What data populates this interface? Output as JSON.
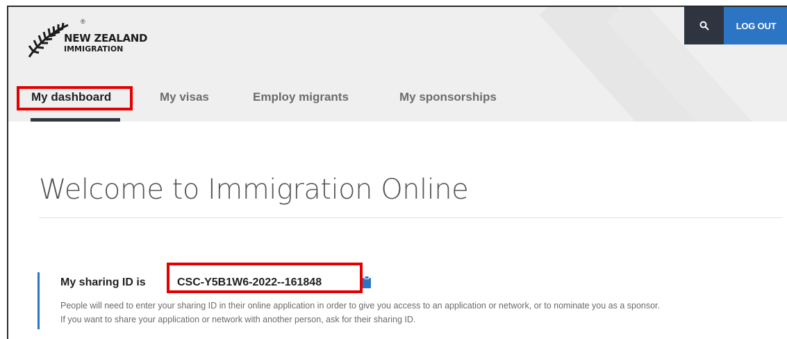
{
  "header": {
    "logo_line1": "NEW ZEALAND",
    "logo_line2": "IMMIGRATION",
    "logo_reg": "®",
    "search_icon": "search-icon",
    "logout_label": "LOG OUT"
  },
  "tabs": [
    {
      "label": "My dashboard",
      "active": true
    },
    {
      "label": "My visas",
      "active": false
    },
    {
      "label": "Employ migrants",
      "active": false
    },
    {
      "label": "My sponsorships",
      "active": false
    }
  ],
  "main": {
    "title": "Welcome to Immigration Online",
    "sharing_label": "My sharing ID is",
    "sharing_id": "CSC-Y5B1W6-2022--161848",
    "copy_icon": "copy-clipboard-icon",
    "description_line1": "People will need to enter your sharing ID in their online application in order to give you access to an application or network, or to nominate you as a sponsor.",
    "description_line2": "If you want to share your application or network with another person, ask for their sharing ID."
  },
  "colors": {
    "header_bg": "#efefef",
    "search_bg": "#2e3540",
    "logout_bg": "#2c74c4",
    "highlight": "#e40000",
    "accent": "#2c74c4"
  }
}
